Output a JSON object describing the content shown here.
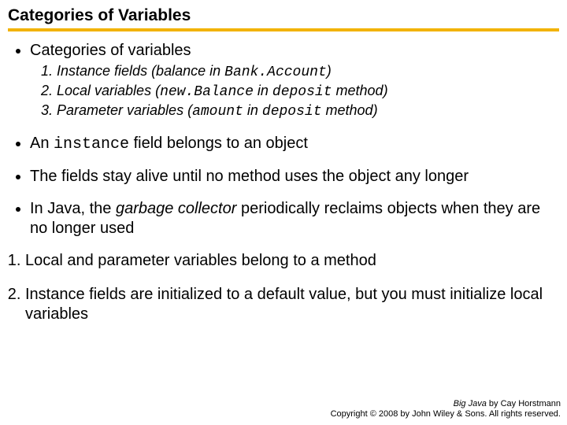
{
  "title": "Categories of Variables",
  "bullets": {
    "b1": "Categories of variables",
    "sub1_pre": "Instance fields (balance in ",
    "sub1_code": "Bank.Account",
    "sub1_post": ")",
    "sub2_pre": "Local variables (",
    "sub2_code1": "new.Balance",
    "sub2_mid": " in ",
    "sub2_code2": "deposit",
    "sub2_post": " method)",
    "sub3_pre": "Parameter variables (",
    "sub3_code1": "amount",
    "sub3_mid": " in ",
    "sub3_code2": "deposit",
    "sub3_post": " method)",
    "b2_pre": "An ",
    "b2_code": "instance",
    "b2_post": " field belongs to an object",
    "b3": "The fields stay alive until no method uses the object any longer",
    "b4_pre": "In Java, the ",
    "b4_ital": "garbage collector",
    "b4_post": " periodically reclaims objects when they are no longer used"
  },
  "numbered": {
    "n1": "Local and parameter variables belong to a method",
    "n2": "Instance fields are initialized to a default value, but you must initialize local variables"
  },
  "footer": {
    "book": "Big Java",
    "author": " by Cay Horstmann",
    "copyright": "Copyright © 2008 by John Wiley & Sons.  All rights reserved."
  }
}
